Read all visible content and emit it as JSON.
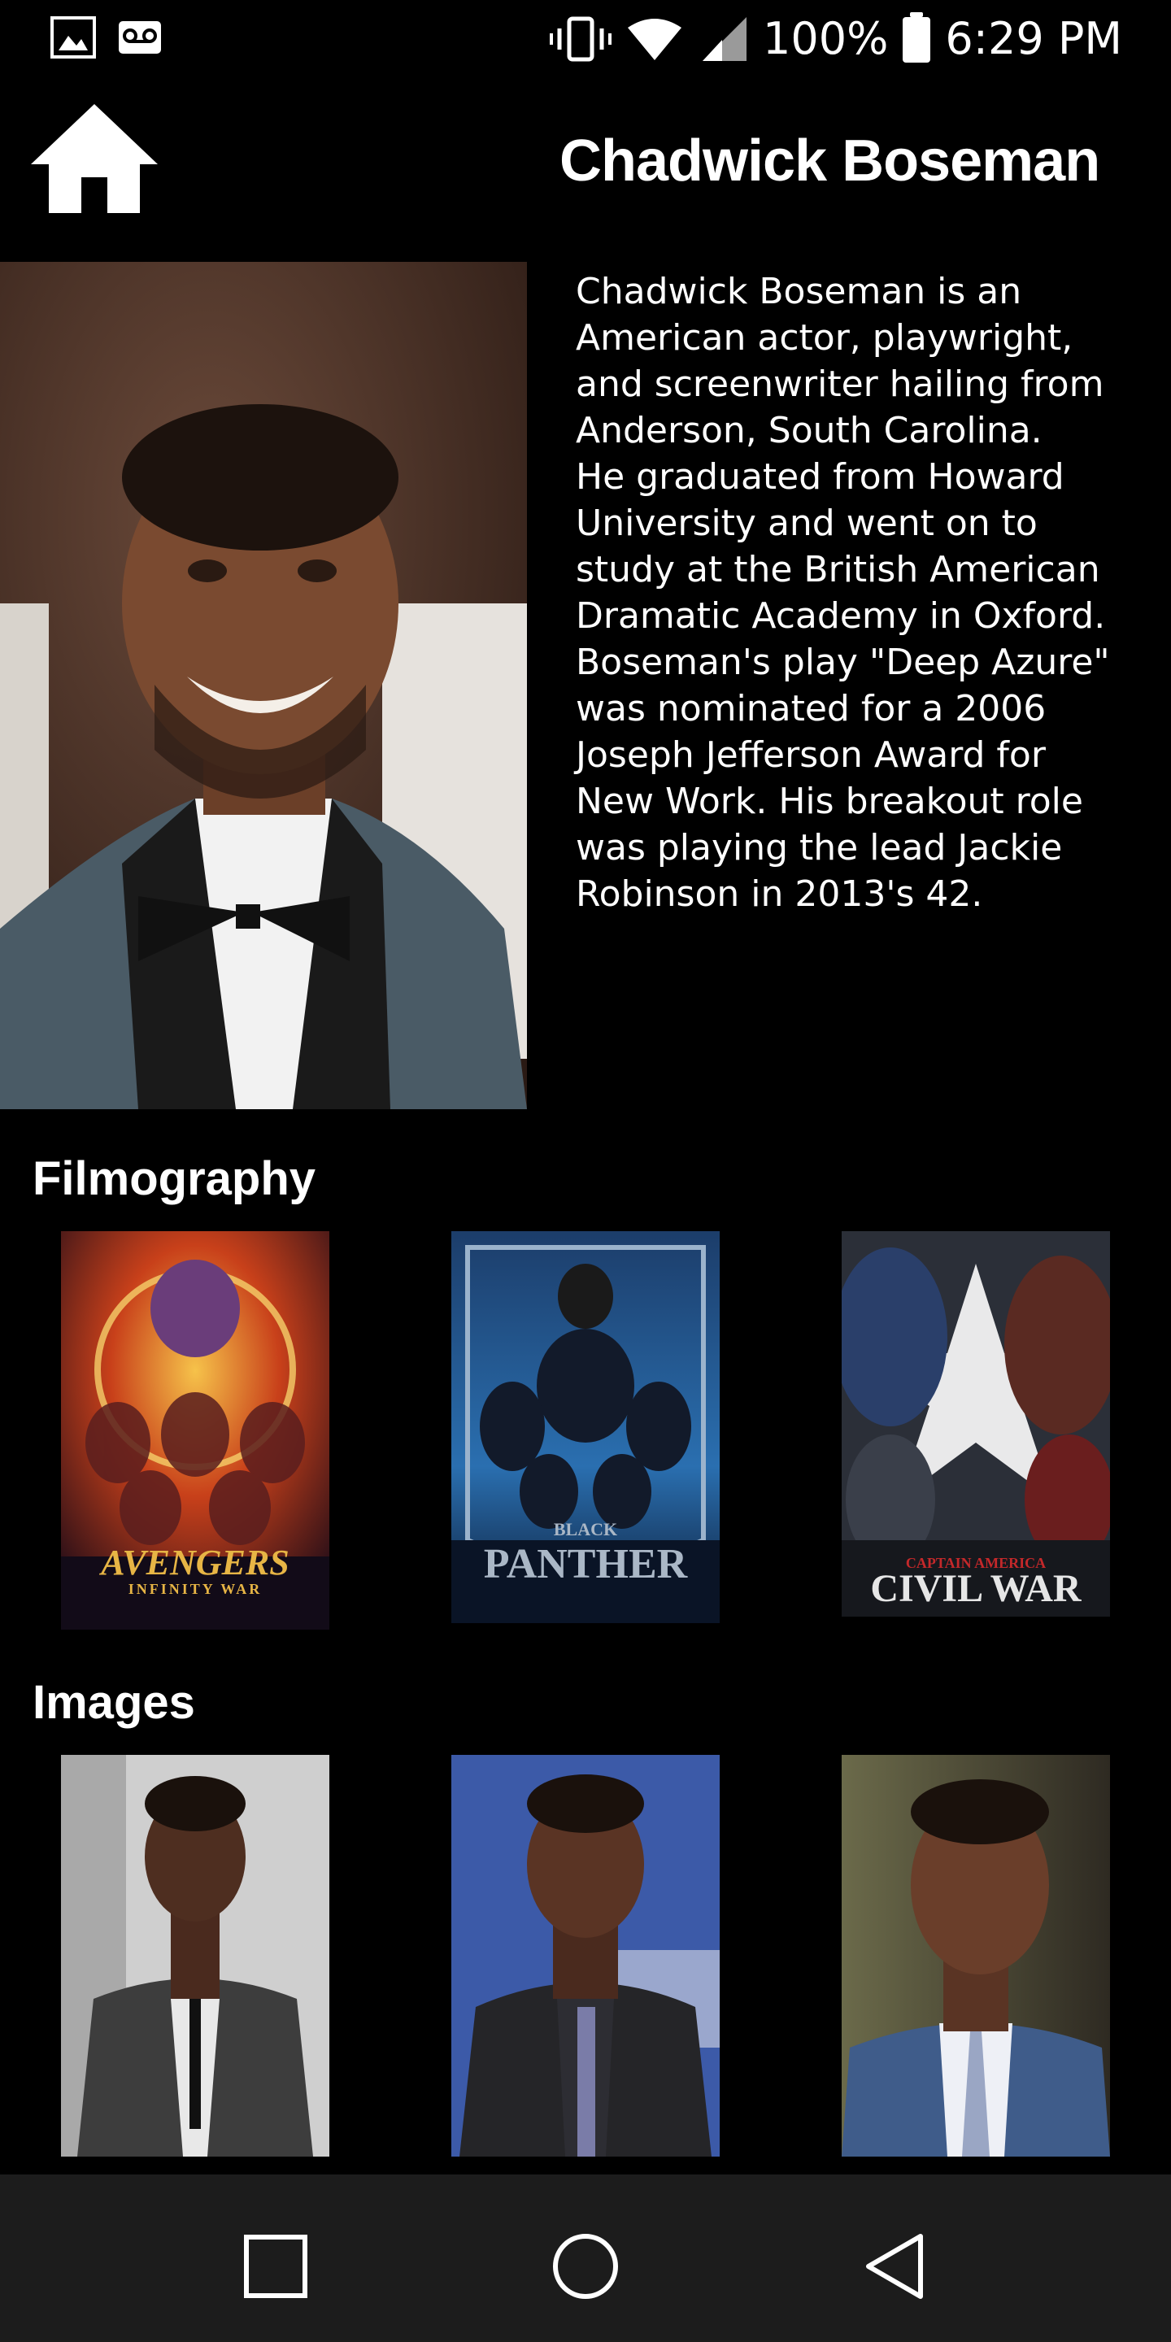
{
  "status_bar": {
    "battery_percent": "100%",
    "time": "6:29 PM",
    "icons": [
      "image-notification-icon",
      "voicemail-icon",
      "vibrate-icon",
      "wifi-icon",
      "signal-icon",
      "battery-icon"
    ]
  },
  "header": {
    "home_icon": "home-icon",
    "title": "Chadwick Boseman"
  },
  "bio": {
    "text": "Chadwick Boseman is an\nAmerican actor, playwright,\nand screenwriter hailing from\nAnderson, South Carolina.\nHe graduated from Howard\nUniversity and went on to\nstudy at the British American\nDramatic Academy in Oxford.\n Boseman's play \"Deep Azure\"\nwas nominated for a 2006\nJoseph Jefferson Award for\nNew Work.  His breakout role\nwas playing the lead Jackie\nRobinson in 2013's 42."
  },
  "filmography": {
    "title": "Filmography",
    "items": [
      {
        "poster_text": "AVENGERS",
        "poster_subtext": "INFINITY WAR"
      },
      {
        "poster_text": "PANTHER",
        "poster_subtext": "BLACK"
      },
      {
        "poster_text": "CIVIL WAR",
        "poster_subtext": "CAPTAIN AMERICA"
      }
    ]
  },
  "images": {
    "title": "Images"
  },
  "nav": {
    "icons": [
      "recents-square-icon",
      "home-circle-icon",
      "back-triangle-icon"
    ]
  }
}
